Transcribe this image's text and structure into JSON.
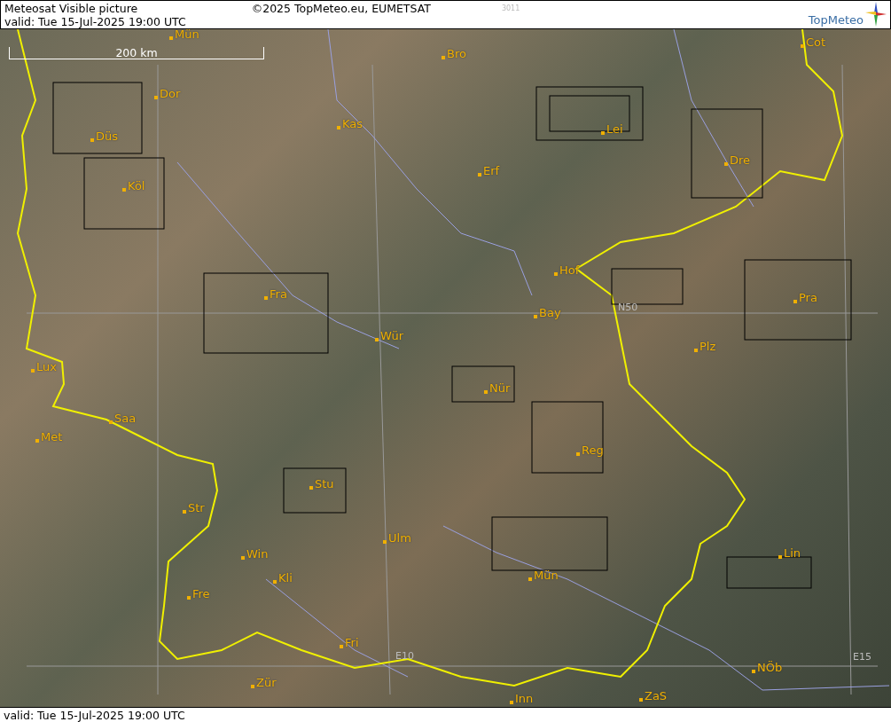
{
  "header": {
    "title": "Meteosat Visible picture",
    "copyright": "©2025 TopMeteo.eu, EUMETSAT",
    "code": "3011",
    "valid": "valid:  Tue  15-Jul-2025  19:00 UTC",
    "logo": "TopMeteo"
  },
  "map": {
    "scale": "200 km",
    "cities": [
      {
        "name": "Mün"
      },
      {
        "name": "Bro"
      },
      {
        "name": "Dor"
      },
      {
        "name": "Kas"
      },
      {
        "name": "Lei"
      },
      {
        "name": "Düs"
      },
      {
        "name": "Cot"
      },
      {
        "name": "Dre"
      },
      {
        "name": "Erf"
      },
      {
        "name": "Köl"
      },
      {
        "name": "Hof"
      },
      {
        "name": "Fra"
      },
      {
        "name": "Pra"
      },
      {
        "name": "Bay"
      },
      {
        "name": "Wür"
      },
      {
        "name": "Plz"
      },
      {
        "name": "Lux"
      },
      {
        "name": "Nür"
      },
      {
        "name": "Saa"
      },
      {
        "name": "Met"
      },
      {
        "name": "Reg"
      },
      {
        "name": "Stu"
      },
      {
        "name": "Str"
      },
      {
        "name": "Ulm"
      },
      {
        "name": "Win"
      },
      {
        "name": "Lin"
      },
      {
        "name": "Kli"
      },
      {
        "name": "Mün"
      },
      {
        "name": "Fre"
      },
      {
        "name": "Fri"
      },
      {
        "name": "NÖb"
      },
      {
        "name": "Zür"
      },
      {
        "name": "Inn"
      },
      {
        "name": "ZaS"
      }
    ],
    "grid_labels": [
      "N50",
      "E10",
      "E15"
    ]
  },
  "footer": {
    "valid": "valid:  Tue  15-Jul-2025  19:00 UTC"
  }
}
